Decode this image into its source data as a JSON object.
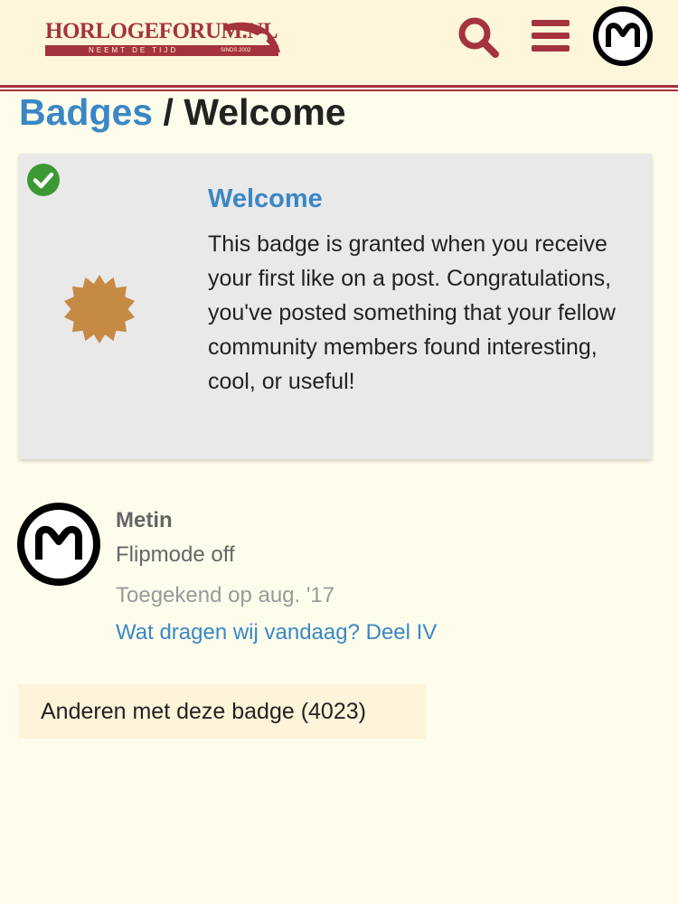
{
  "header": {
    "logo": {
      "name": "HORLOGEFORUM.NL",
      "tagline": "NEEMT DE TIJD",
      "since": "SINDS 2002"
    },
    "search_icon": "search-icon",
    "menu_icon": "hamburger-menu-icon",
    "user_initial_icon": "user-avatar-m-icon"
  },
  "breadcrumb": {
    "parent": "Badges",
    "separator": "/",
    "current": "Welcome"
  },
  "badge": {
    "name": "Welcome",
    "description": "This badge is granted when you receive your first like on a post. Congratulations, you've posted something that your fellow community members found interesting, cool, or useful!",
    "granted_icon": "check-circle-icon",
    "badge_icon": "bronze-badge-icon"
  },
  "user": {
    "username": "Metin",
    "title": "Flipmode off",
    "granted_at": "Toegekend op aug. '17",
    "topic": "Wat dragen wij vandaag? Deel IV"
  },
  "others": {
    "label": "Anderen met deze badge (4023)"
  },
  "colors": {
    "background": "#fefdec",
    "header_background": "#fef6da",
    "brand_red": "#a5333f",
    "link_blue": "#3b87c5",
    "badge_bronze": "#c58a44",
    "check_green": "#3b9a34",
    "card_background": "#e9e9e9"
  }
}
